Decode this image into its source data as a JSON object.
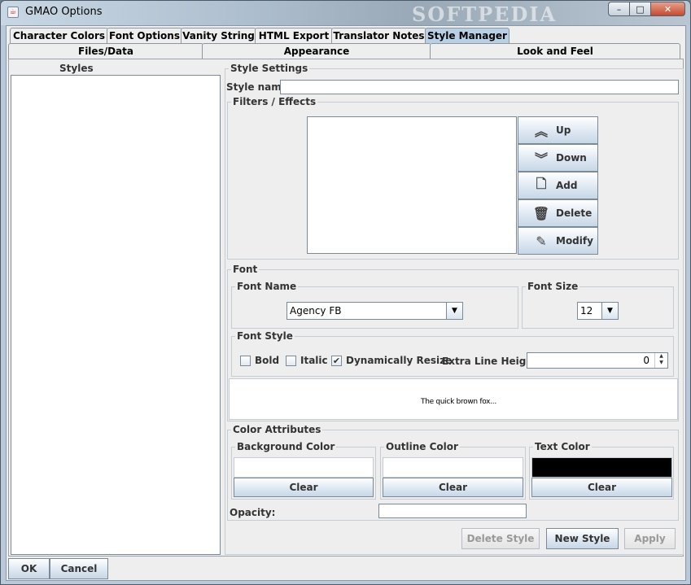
{
  "window": {
    "title": "GMAO Options",
    "watermark": "SOFTPEDIA",
    "caption_minimize": "–",
    "caption_maximize": "□",
    "caption_close": "✕"
  },
  "tabs_row1": [
    "Character Colors",
    "Font Options",
    "Vanity String",
    "HTML Export",
    "Translator Notes",
    "Style Manager"
  ],
  "tabs_row2": [
    "Files/Data",
    "Appearance",
    "Look and Feel"
  ],
  "styles_panel": {
    "title": "Styles"
  },
  "style_settings": {
    "title": "Style Settings",
    "style_name_label": "Style name:",
    "style_name_value": ""
  },
  "filters": {
    "title": "Filters / Effects",
    "buttons": {
      "up": "Up",
      "down": "Down",
      "add": "Add",
      "delete": "Delete",
      "modify": "Modify"
    }
  },
  "font": {
    "title": "Font",
    "font_name_title": "Font Name",
    "font_name_value": "Agency FB",
    "font_size_title": "Font Size",
    "font_size_value": "12",
    "font_style_title": "Font Style",
    "bold_label": "Bold",
    "bold_checked": false,
    "italic_label": "Italic",
    "italic_checked": false,
    "dyn_resize_label": "Dynamically Resize",
    "dyn_resize_checked": true,
    "check_mark": "✔",
    "extra_line_height_label": "Extra Line Height:",
    "extra_line_height_value": "0",
    "preview_text": "The quick brown fox..."
  },
  "color_attributes": {
    "title": "Color Attributes",
    "background_label": "Background Color",
    "background_color": "#ffffff",
    "outline_label": "Outline Color",
    "outline_color": "#ffffff",
    "text_label": "Text Color",
    "text_color": "#000000",
    "clear_label": "Clear",
    "opacity_label": "Opacity:",
    "opacity_value": ""
  },
  "actions": {
    "delete_style": "Delete Style",
    "new_style": "New Style",
    "apply": "Apply"
  },
  "footer": {
    "ok": "OK",
    "cancel": "Cancel"
  },
  "colors": {
    "selected_tab": "#b8cfe5",
    "panel_bg": "#eeeeee"
  }
}
